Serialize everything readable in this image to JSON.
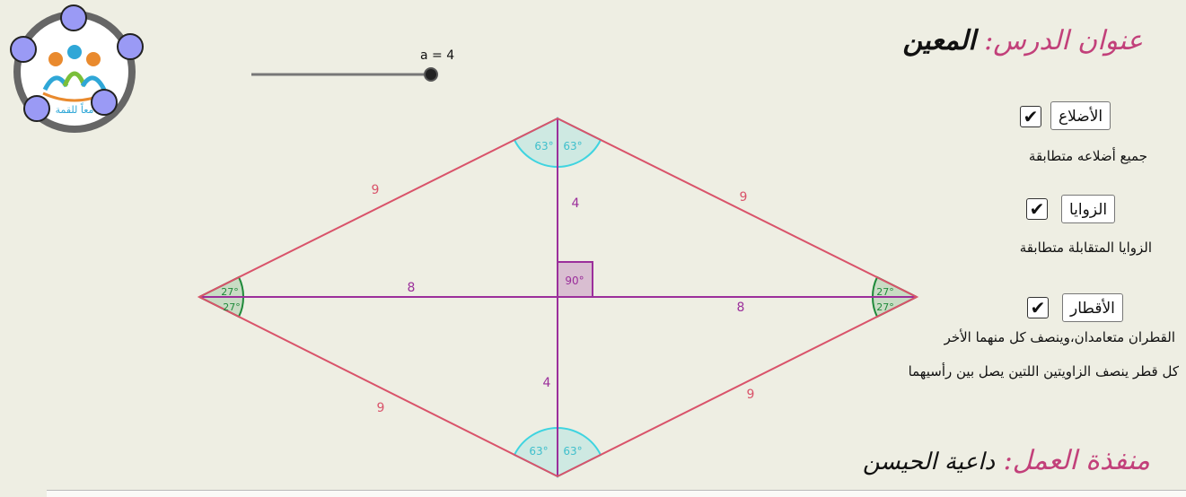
{
  "lesson": {
    "label": "عنوان الدرس:",
    "value": "المعين"
  },
  "maker": {
    "label": "منفذة العمل:",
    "value": "داعية الحيسن"
  },
  "logo": {
    "text": "معاً للقمة"
  },
  "slider": {
    "label": "a = 4",
    "value": 4
  },
  "options": [
    {
      "label": "الأضلاع",
      "checked": true,
      "description": "جميع أضلاعه متطابقة"
    },
    {
      "label": "الزوايا",
      "checked": true,
      "description": "الزوايا المتقابلة متطابقة"
    },
    {
      "label": "الأقطار",
      "checked": true,
      "description": "القطران متعامدان،وينصف كل منهما الأخر",
      "description2": "كل قطر ينصف الزاويتين اللتين يصل بين رأسيهما"
    }
  ],
  "figure": {
    "side_labels": [
      "9",
      "9",
      "9",
      "9"
    ],
    "half_diagonal_labels": [
      "4",
      "4",
      "8",
      "8"
    ],
    "vertical_angles": [
      "63°",
      "63°",
      "63°",
      "63°"
    ],
    "horizontal_angles": [
      "27°",
      "27°",
      "27°",
      "27°"
    ],
    "right_angle": "90°"
  },
  "colors": {
    "side": "#d9536a",
    "diagonal": "#9b2f9b",
    "angle_arc": "#3fd4e0",
    "side_angle": "#1f8a3a",
    "accent_pink": "#c2407a",
    "logo_node": "#9a9af5"
  },
  "icons": [
    "check-icon",
    "logo-icon"
  ]
}
